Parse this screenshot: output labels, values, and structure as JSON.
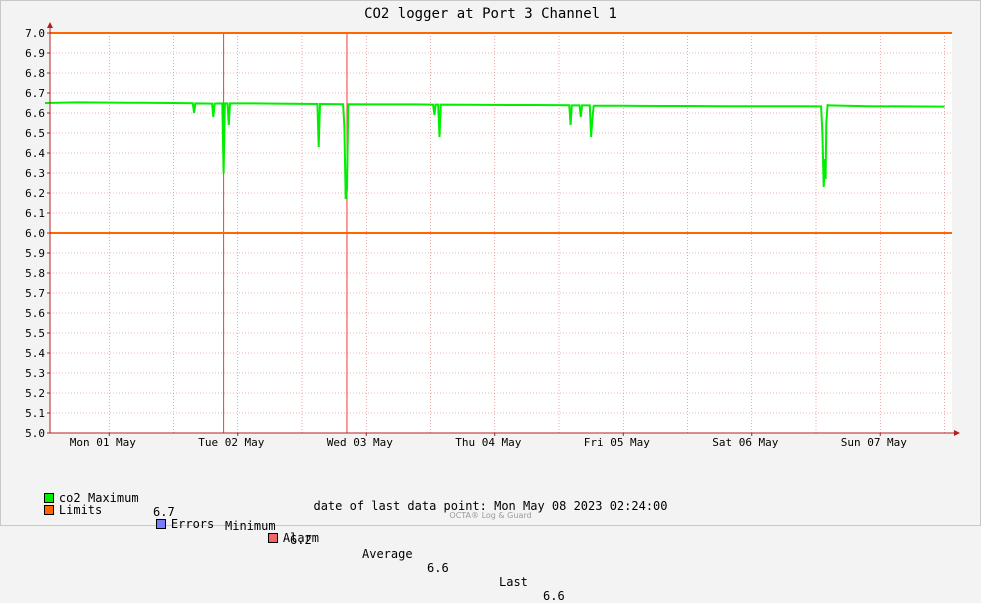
{
  "chart_data": {
    "type": "line",
    "title": "CO2 logger at Port 3 Channel 1",
    "ylim": [
      5.0,
      7.0
    ],
    "y_ticks": [
      "5.0",
      "5.1",
      "5.2",
      "5.3",
      "5.4",
      "5.5",
      "5.6",
      "5.7",
      "5.8",
      "5.9",
      "6.0",
      "6.1",
      "6.2",
      "6.3",
      "6.4",
      "6.5",
      "6.6",
      "6.7",
      "6.8",
      "6.9",
      "7.0"
    ],
    "x_ticks": [
      "Mon 01 May",
      "Tue 02 May",
      "Wed 03 May",
      "Thu 04 May",
      "Fri 05 May",
      "Sat 06 May",
      "Sun 07 May"
    ],
    "xlim_days": [
      0.0,
      7.0
    ],
    "grid": true,
    "limits": [
      6.0,
      7.0
    ],
    "alarm_days": [
      1.39,
      2.35
    ],
    "colors": {
      "co2": "#00ee00",
      "limits": "#ff6600",
      "errors": "#7b7bff",
      "alarm": "#ee6666",
      "grid": "#e06a6a"
    },
    "series": [
      {
        "name": "co2",
        "points": [
          [
            0.0,
            6.65
          ],
          [
            0.25,
            6.653
          ],
          [
            0.5,
            6.652
          ],
          [
            0.75,
            6.651
          ],
          [
            1.0,
            6.65
          ],
          [
            1.15,
            6.649
          ],
          [
            1.16,
            6.6
          ],
          [
            1.17,
            6.648
          ],
          [
            1.3,
            6.647
          ],
          [
            1.31,
            6.58
          ],
          [
            1.32,
            6.647
          ],
          [
            1.38,
            6.648
          ],
          [
            1.39,
            6.3
          ],
          [
            1.4,
            6.648
          ],
          [
            1.42,
            6.648
          ],
          [
            1.43,
            6.54
          ],
          [
            1.44,
            6.648
          ],
          [
            1.6,
            6.648
          ],
          [
            1.8,
            6.647
          ],
          [
            2.12,
            6.645
          ],
          [
            2.13,
            6.43
          ],
          [
            2.14,
            6.645
          ],
          [
            2.32,
            6.644
          ],
          [
            2.33,
            6.53
          ],
          [
            2.34,
            6.17
          ],
          [
            2.35,
            6.22
          ],
          [
            2.36,
            6.644
          ],
          [
            2.6,
            6.643
          ],
          [
            2.9,
            6.643
          ],
          [
            3.0,
            6.642
          ],
          [
            3.02,
            6.642
          ],
          [
            3.03,
            6.59
          ],
          [
            3.04,
            6.642
          ],
          [
            3.06,
            6.642
          ],
          [
            3.07,
            6.48
          ],
          [
            3.08,
            6.642
          ],
          [
            3.3,
            6.641
          ],
          [
            3.6,
            6.64
          ],
          [
            3.8,
            6.64
          ],
          [
            4.08,
            6.639
          ],
          [
            4.09,
            6.54
          ],
          [
            4.1,
            6.638
          ],
          [
            4.16,
            6.638
          ],
          [
            4.17,
            6.58
          ],
          [
            4.18,
            6.638
          ],
          [
            4.24,
            6.638
          ],
          [
            4.25,
            6.48
          ],
          [
            4.26,
            6.57
          ],
          [
            4.27,
            6.636
          ],
          [
            4.5,
            6.636
          ],
          [
            4.8,
            6.635
          ],
          [
            5.0,
            6.635
          ],
          [
            5.3,
            6.634
          ],
          [
            5.6,
            6.634
          ],
          [
            5.9,
            6.634
          ],
          [
            6.02,
            6.633
          ],
          [
            6.04,
            6.633
          ],
          [
            6.05,
            6.5
          ],
          [
            6.06,
            6.23
          ],
          [
            6.07,
            6.37
          ],
          [
            6.075,
            6.27
          ],
          [
            6.08,
            6.55
          ],
          [
            6.09,
            6.64
          ],
          [
            6.1,
            6.638
          ],
          [
            6.4,
            6.634
          ],
          [
            6.7,
            6.633
          ],
          [
            7.0,
            6.632
          ]
        ]
      }
    ]
  },
  "legend": {
    "co2_label": "co2",
    "max_label": "Maximum",
    "max_value": "6.7",
    "min_label": "Minimum",
    "min_value": "6.2",
    "avg_label": "Average",
    "avg_value": "6.6",
    "last_label": "Last",
    "last_value": "6.6",
    "limits_label": "Limits",
    "errors_label": "Errors",
    "alarm_label": "Alarm"
  },
  "footer": {
    "last_point_label": "date of last data point:",
    "last_point_value": "Mon May 08 2023 02:24:00",
    "brand": "OCTA® Log & Guard"
  }
}
